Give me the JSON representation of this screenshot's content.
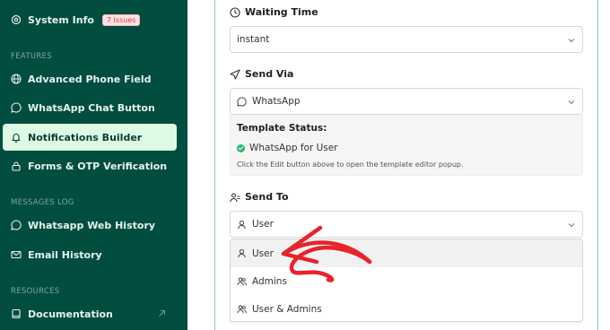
{
  "sidebar": {
    "system_info": {
      "label": "System Info",
      "badge": "7 Issues"
    },
    "features_heading": "FEATURES",
    "items": [
      {
        "label": "Advanced Phone Field",
        "icon": "globe-icon"
      },
      {
        "label": "WhatsApp Chat Button",
        "icon": "whatsapp-icon"
      },
      {
        "label": "Notifications Builder",
        "icon": "bell-icon",
        "active": true
      },
      {
        "label": "Forms & OTP Verification",
        "icon": "lock-icon"
      }
    ],
    "messages_heading": "MESSAGES LOG",
    "log_items": [
      {
        "label": "Whatsapp Web History",
        "icon": "whatsapp-icon"
      },
      {
        "label": "Email History",
        "icon": "mail-icon"
      }
    ],
    "resources_heading": "RESOURCES",
    "resources_items": [
      {
        "label": "Documentation",
        "icon": "book-icon"
      }
    ]
  },
  "form": {
    "waiting_time": {
      "label": "Waiting Time",
      "value": "instant"
    },
    "send_via": {
      "label": "Send Via",
      "value": "WhatsApp"
    },
    "template_status": {
      "title": "Template Status:",
      "status": "WhatsApp for User",
      "note": "Click the Edit button above to open the template editor popup."
    },
    "send_to": {
      "label": "Send To",
      "value": "User",
      "options": [
        "User",
        "Admins",
        "User & Admins"
      ]
    }
  },
  "colors": {
    "sidebar_bg": "#014d40",
    "active_bg": "#dcfbe2",
    "panel_border": "#7fd3a0",
    "badge": "#e23a3a",
    "status_ok": "#2bb673",
    "arrow": "#e8232a"
  }
}
